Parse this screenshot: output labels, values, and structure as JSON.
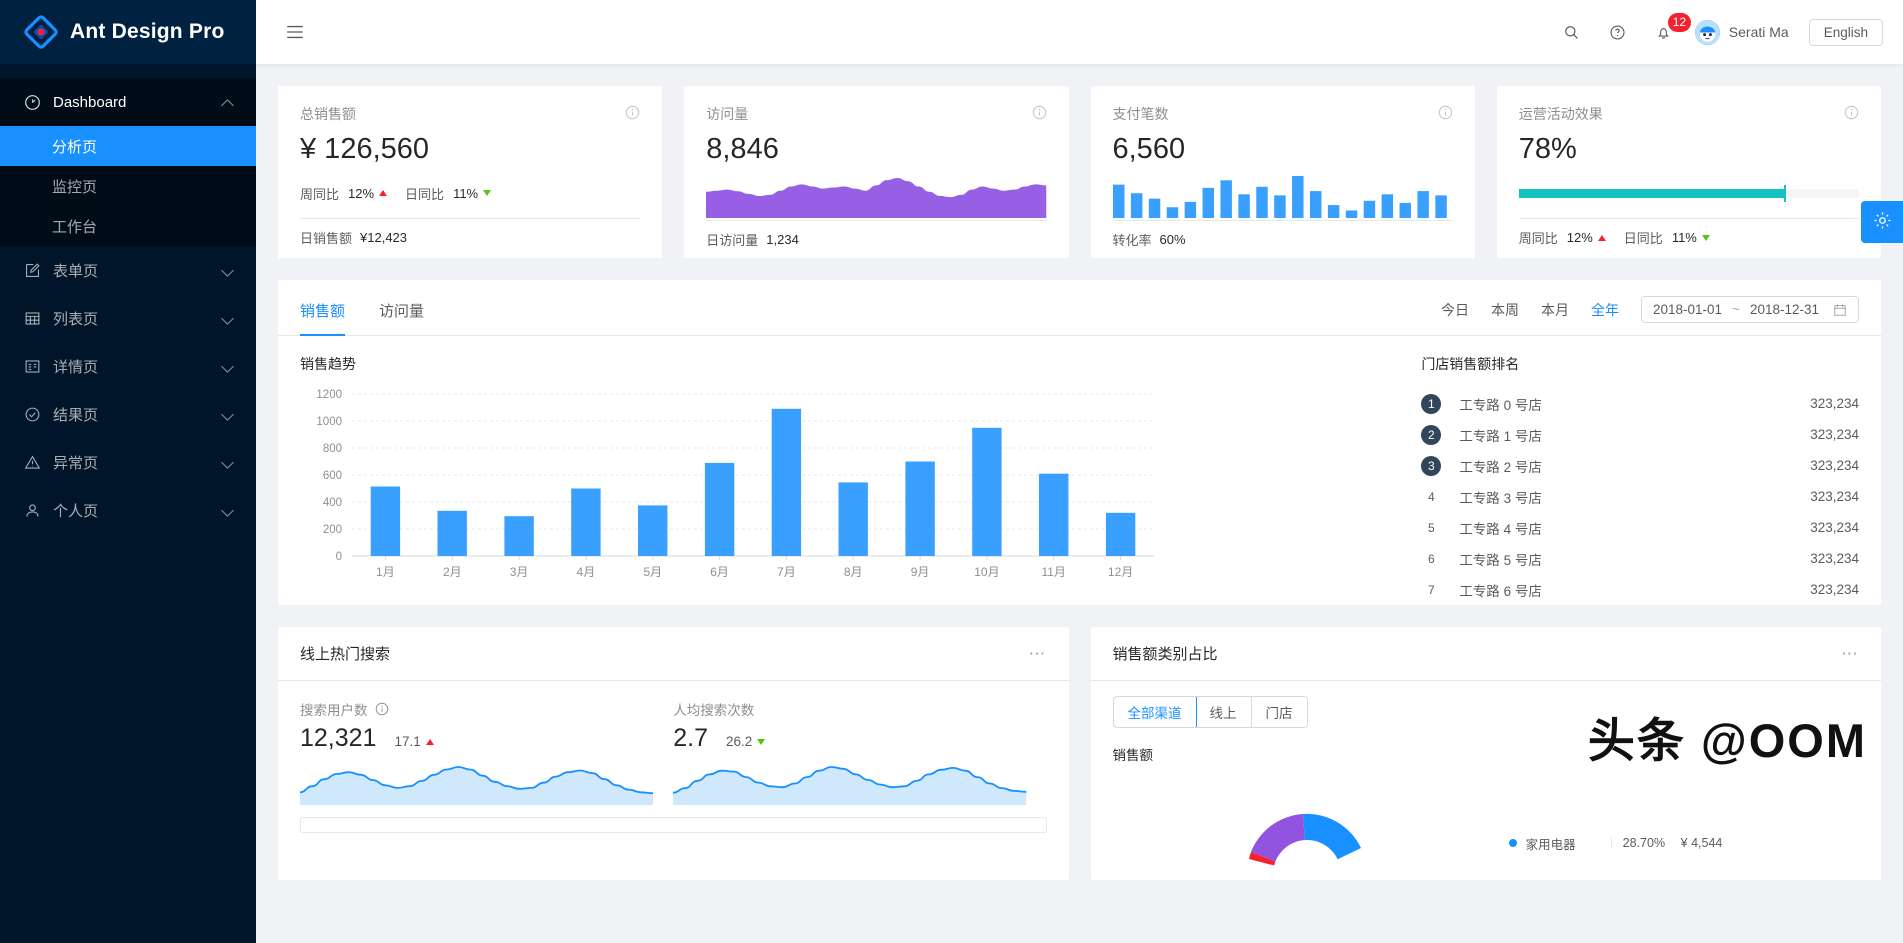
{
  "sidebar": {
    "brand": "Ant Design Pro",
    "items": [
      {
        "label": "Dashboard",
        "icon": "dashboard-icon",
        "expanded": true,
        "children": [
          {
            "label": "分析页",
            "active": true
          },
          {
            "label": "监控页",
            "active": false
          },
          {
            "label": "工作台",
            "active": false
          }
        ]
      },
      {
        "label": "表单页",
        "icon": "form-icon",
        "expanded": false
      },
      {
        "label": "列表页",
        "icon": "table-icon",
        "expanded": false
      },
      {
        "label": "详情页",
        "icon": "profile-icon",
        "expanded": false
      },
      {
        "label": "结果页",
        "icon": "check-circle-icon",
        "expanded": false
      },
      {
        "label": "异常页",
        "icon": "warning-icon",
        "expanded": false
      },
      {
        "label": "个人页",
        "icon": "user-icon",
        "expanded": false
      }
    ]
  },
  "topbar": {
    "collapse_icon": "menu-fold-icon",
    "search_icon": "search-icon",
    "help_icon": "question-circle-icon",
    "bell_icon": "bell-icon",
    "notification_count": "12",
    "user_name": "Serati Ma",
    "lang_label": "English"
  },
  "stats": [
    {
      "title": "总销售额",
      "value": "¥ 126,560",
      "type": "trends",
      "trends": [
        {
          "label": "周同比",
          "value": "12%",
          "dir": "up"
        },
        {
          "label": "日同比",
          "value": "11%",
          "dir": "down"
        }
      ],
      "footer_label": "日销售额",
      "footer_value": "¥12,423"
    },
    {
      "title": "访问量",
      "value": "8,846",
      "type": "area",
      "footer_label": "日访问量",
      "footer_value": "1,234"
    },
    {
      "title": "支付笔数",
      "value": "6,560",
      "type": "bars",
      "footer_label": "转化率",
      "footer_value": "60%"
    },
    {
      "title": "运营活动效果",
      "value": "78%",
      "type": "progress",
      "progress_percent": 78,
      "trends": [
        {
          "label": "周同比",
          "value": "12%",
          "dir": "up"
        },
        {
          "label": "日同比",
          "value": "11%",
          "dir": "down"
        }
      ]
    }
  ],
  "panel": {
    "tabs": [
      {
        "label": "销售额",
        "active": true
      },
      {
        "label": "访问量",
        "active": false
      }
    ],
    "filters": [
      {
        "label": "今日",
        "active": false
      },
      {
        "label": "本周",
        "active": false
      },
      {
        "label": "本月",
        "active": false
      },
      {
        "label": "全年",
        "active": true
      }
    ],
    "date_start": "2018-01-01",
    "date_sep": "~",
    "date_end": "2018-12-31",
    "calendar_icon": "calendar-icon",
    "chart_title": "销售趋势",
    "rank_title": "门店销售额排名",
    "ranks": [
      {
        "no": "1",
        "name": "工专路 0 号店",
        "value": "323,234"
      },
      {
        "no": "2",
        "name": "工专路 1 号店",
        "value": "323,234"
      },
      {
        "no": "3",
        "name": "工专路 2 号店",
        "value": "323,234"
      },
      {
        "no": "4",
        "name": "工专路 3 号店",
        "value": "323,234"
      },
      {
        "no": "5",
        "name": "工专路 4 号店",
        "value": "323,234"
      },
      {
        "no": "6",
        "name": "工专路 5 号店",
        "value": "323,234"
      },
      {
        "no": "7",
        "name": "工专路 6 号店",
        "value": "323,234"
      }
    ]
  },
  "hot_search": {
    "title": "线上热门搜索",
    "more_icon": "ellipsis-icon",
    "metrics": [
      {
        "label": "搜索用户数",
        "has_info": true,
        "value": "12,321",
        "delta": "17.1",
        "dir": "up"
      },
      {
        "label": "人均搜索次数",
        "has_info": false,
        "value": "2.7",
        "delta": "26.2",
        "dir": "down"
      }
    ]
  },
  "sales_category": {
    "title": "销售额类别占比",
    "more_icon": "ellipsis-icon",
    "segments": [
      {
        "label": "全部渠道",
        "active": true
      },
      {
        "label": "线上",
        "active": false
      },
      {
        "label": "门店",
        "active": false
      }
    ],
    "sub_title": "销售额",
    "legend": [
      {
        "name": "家用电器",
        "pct": "28.70%",
        "value": "¥ 4,544",
        "color": "#1890ff"
      }
    ]
  },
  "watermark": "头条 @OOM",
  "settings": {
    "icon": "setting-icon"
  },
  "colors": {
    "primary": "#1890ff",
    "sider": "#001529",
    "sider_dark": "#000c17",
    "purple": "#975fe4",
    "teal": "#13c2c2",
    "up": "#f5222d",
    "down": "#52c41a",
    "rank_badge": "#314659"
  },
  "chart_data": {
    "type": "bar",
    "title": "销售趋势",
    "categories": [
      "1月",
      "2月",
      "3月",
      "4月",
      "5月",
      "6月",
      "7月",
      "8月",
      "9月",
      "10月",
      "11月",
      "12月"
    ],
    "values": [
      515,
      335,
      295,
      500,
      375,
      690,
      1090,
      545,
      700,
      950,
      610,
      320
    ],
    "xlabel": "",
    "ylabel": "",
    "ylim": [
      0,
      1200
    ],
    "yticks": [
      0,
      200,
      400,
      600,
      800,
      1000,
      1200
    ],
    "grid": true,
    "legend": "none",
    "series_color": "#3aa0ff"
  },
  "sparklines": {
    "visits_area": [
      42,
      44,
      46,
      43,
      38,
      34,
      36,
      44,
      52,
      56,
      52,
      48,
      50,
      52,
      48,
      44,
      54,
      64,
      68,
      62,
      52,
      42,
      34,
      32,
      36,
      46,
      52,
      48,
      44,
      46,
      52,
      56,
      54
    ],
    "payments_bars": [
      62,
      46,
      36,
      20,
      30,
      56,
      70,
      44,
      58,
      42,
      78,
      50,
      24,
      14,
      32,
      44,
      28,
      50,
      42
    ],
    "search_users": [
      20,
      34,
      50,
      62,
      66,
      60,
      48,
      36,
      30,
      34,
      46,
      60,
      72,
      78,
      72,
      58,
      44,
      34,
      28,
      30,
      42,
      56,
      66,
      70,
      64,
      50,
      36,
      26,
      20,
      18
    ],
    "search_per_user": [
      18,
      28,
      44,
      58,
      66,
      64,
      52,
      40,
      32,
      30,
      38,
      52,
      66,
      74,
      70,
      58,
      46,
      36,
      30,
      32,
      44,
      58,
      68,
      72,
      66,
      52,
      38,
      28,
      22,
      20
    ]
  }
}
